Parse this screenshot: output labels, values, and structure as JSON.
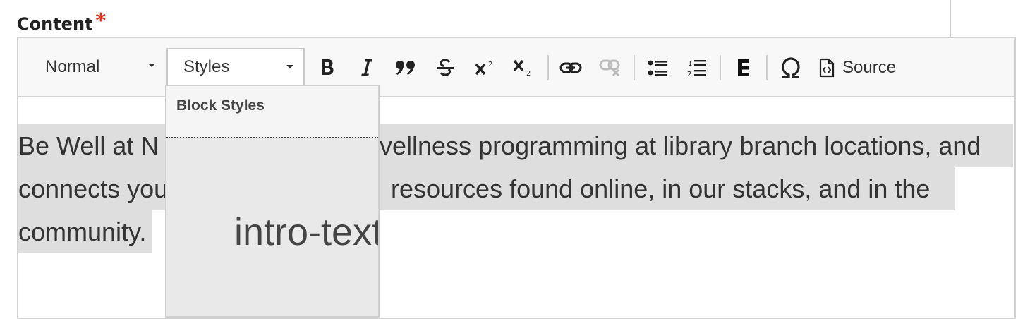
{
  "field": {
    "label": "Content",
    "required_mark": "*"
  },
  "toolbar": {
    "format_combo": "Normal",
    "styles_combo": "Styles",
    "source_label": "Source",
    "buttons": [
      "bold-icon",
      "italic-icon",
      "blockquote-icon",
      "strikethrough-icon",
      "superscript-icon",
      "subscript-icon",
      "link-icon",
      "unlink-icon",
      "bulleted-list-icon",
      "numbered-list-icon",
      "embed-icon",
      "special-character-icon",
      "source-icon"
    ]
  },
  "styles_dropdown": {
    "header": "Block Styles",
    "items": [
      "intro-text"
    ]
  },
  "content": {
    "lines": [
      "Be Well at N",
      "vellness programming at library branch locations, and",
      "connects you",
      "resources found online, in our stacks, and in the",
      "community."
    ]
  }
}
